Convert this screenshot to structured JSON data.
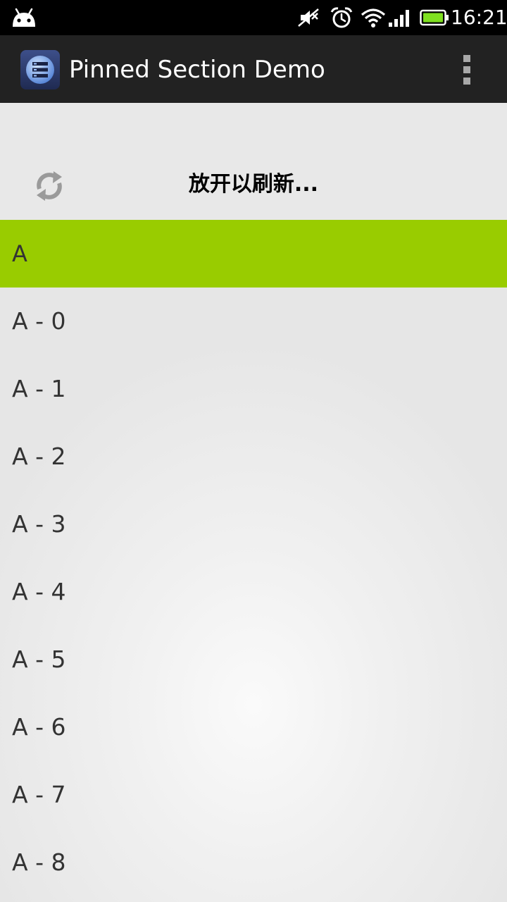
{
  "status_bar": {
    "time": "16:21",
    "icons": [
      "android-icon",
      "mute-icon",
      "alarm-icon",
      "wifi-icon",
      "signal-icon",
      "battery-icon"
    ],
    "battery_color": "#7fe020"
  },
  "action_bar": {
    "title": "Pinned Section Demo",
    "icon": "app-list-icon",
    "overflow_icon": "overflow-menu-icon"
  },
  "refresh": {
    "label": "放开以刷新...",
    "icon": "refresh-icon"
  },
  "list": {
    "section_color": "#99cc00",
    "section": "A",
    "items": [
      "A - 0",
      "A - 1",
      "A - 2",
      "A - 3",
      "A - 4",
      "A - 5",
      "A - 6",
      "A - 7",
      "A - 8"
    ]
  }
}
